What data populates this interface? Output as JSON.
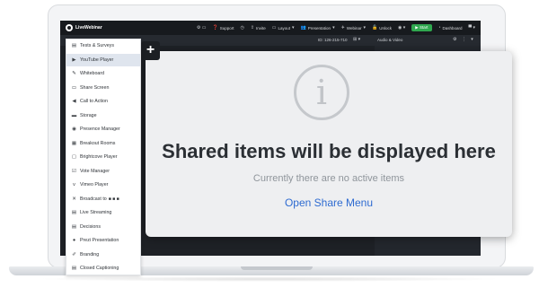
{
  "app": {
    "brand": "LiveWebinar",
    "nav": [
      {
        "key": "support",
        "label": "Support"
      },
      {
        "key": "invite",
        "label": "Invite"
      },
      {
        "key": "layout",
        "label": "Layout"
      },
      {
        "key": "presentation",
        "label": "Presentation"
      },
      {
        "key": "webinar",
        "label": "Webinar"
      },
      {
        "key": "unlock",
        "label": "Unlock"
      },
      {
        "key": "start",
        "label": "Start"
      },
      {
        "key": "dashboard",
        "label": "Dashboard"
      }
    ],
    "room_id": "ID: 126-215-710",
    "audio_video_label": "Audio & Video"
  },
  "share_panel": {
    "title": "Shared items will be displayed here",
    "subtitle": "Currently there are no active items",
    "link": "Open Share Menu",
    "icon": "info-icon"
  },
  "add_button": {
    "label": "+"
  },
  "menu": {
    "items": [
      {
        "label": "Tests & Surveys",
        "icon": "survey-icon",
        "active": false
      },
      {
        "label": "YouTube Player",
        "icon": "youtube-icon",
        "active": true
      },
      {
        "label": "Whiteboard",
        "icon": "pen-icon",
        "active": false
      },
      {
        "label": "Share Screen",
        "icon": "screen-icon",
        "active": false
      },
      {
        "label": "Call to Action",
        "icon": "megaphone-icon",
        "active": false
      },
      {
        "label": "Storage",
        "icon": "folder-icon",
        "active": false
      },
      {
        "label": "Presence Manager",
        "icon": "eye-icon",
        "active": false
      },
      {
        "label": "Breakout Rooms",
        "icon": "grid-icon",
        "active": false
      },
      {
        "label": "Brightcove Player",
        "icon": "player-icon",
        "active": false
      },
      {
        "label": "Vote Manager",
        "icon": "checkbox-icon",
        "active": false
      },
      {
        "label": "Vimeo Player",
        "icon": "vimeo-icon",
        "active": false
      },
      {
        "label": "Broadcast to",
        "icon": "broadcast-icon",
        "active": false
      },
      {
        "label": "Live Streaming",
        "icon": "stream-icon",
        "active": false
      },
      {
        "label": "Decisions",
        "icon": "list-icon",
        "active": false
      },
      {
        "label": "Prezi Presentation",
        "icon": "prezi-icon",
        "active": false
      },
      {
        "label": "Branding",
        "icon": "brush-icon",
        "active": false
      },
      {
        "label": "Closed Captioning",
        "icon": "cc-icon",
        "active": false
      }
    ]
  }
}
